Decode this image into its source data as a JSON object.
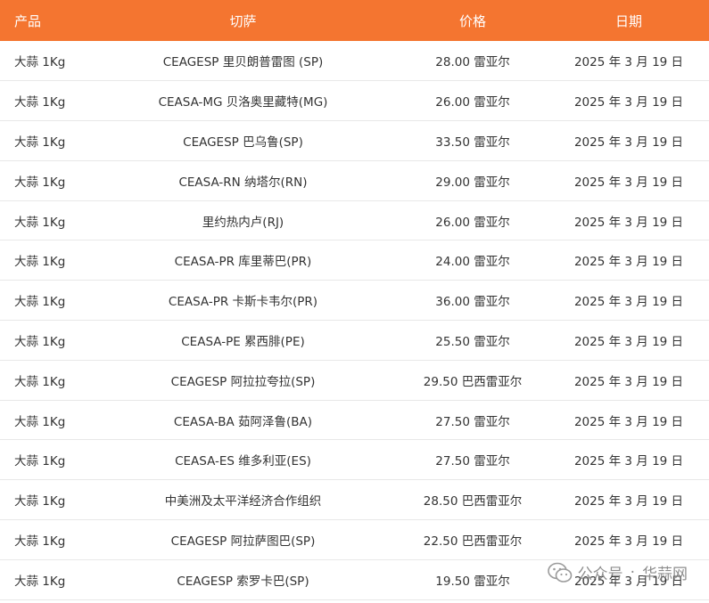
{
  "colors": {
    "header_background": "#f47530",
    "header_text": "#ffffff",
    "body_text": "#333333",
    "row_divider": "#e8e8e8"
  },
  "table": {
    "headers": {
      "product": "产品",
      "market": "切萨",
      "price": "价格",
      "date": "日期"
    },
    "rows": [
      {
        "product": "大蒜 1Kg",
        "market": "CEAGESP 里贝朗普雷图 (SP)",
        "price": "28.00 雷亚尔",
        "date": "2025 年 3 月 19 日"
      },
      {
        "product": "大蒜 1Kg",
        "market": "CEASA-MG 贝洛奥里藏特(MG)",
        "price": "26.00 雷亚尔",
        "date": "2025 年 3 月 19 日"
      },
      {
        "product": "大蒜 1Kg",
        "market": "CEAGESP 巴乌鲁(SP)",
        "price": "33.50 雷亚尔",
        "date": "2025 年 3 月 19 日"
      },
      {
        "product": "大蒜 1Kg",
        "market": "CEASA-RN 纳塔尔(RN)",
        "price": "29.00 雷亚尔",
        "date": "2025 年 3 月 19 日"
      },
      {
        "product": "大蒜 1Kg",
        "market": "里约热内卢(RJ)",
        "price": "26.00 雷亚尔",
        "date": "2025 年 3 月 19 日"
      },
      {
        "product": "大蒜 1Kg",
        "market": "CEASA-PR 库里蒂巴(PR)",
        "price": "24.00 雷亚尔",
        "date": "2025 年 3 月 19 日"
      },
      {
        "product": "大蒜 1Kg",
        "market": "CEASA-PR 卡斯卡韦尔(PR)",
        "price": "36.00 雷亚尔",
        "date": "2025 年 3 月 19 日"
      },
      {
        "product": "大蒜 1Kg",
        "market": "CEASA-PE 累西腓(PE)",
        "price": "25.50 雷亚尔",
        "date": "2025 年 3 月 19 日"
      },
      {
        "product": "大蒜 1Kg",
        "market": "CEAGESP 阿拉拉夸拉(SP)",
        "price": "29.50 巴西雷亚尔",
        "date": "2025 年 3 月 19 日"
      },
      {
        "product": "大蒜 1Kg",
        "market": "CEASA-BA 茹阿泽鲁(BA)",
        "price": "27.50 雷亚尔",
        "date": "2025 年 3 月 19 日"
      },
      {
        "product": "大蒜 1Kg",
        "market": "CEASA-ES 维多利亚(ES)",
        "price": "27.50 雷亚尔",
        "date": "2025 年 3 月 19 日"
      },
      {
        "product": "大蒜 1Kg",
        "market": "中美洲及太平洋经济合作组织",
        "price": "28.50 巴西雷亚尔",
        "date": "2025 年 3 月 19 日"
      },
      {
        "product": "大蒜 1Kg",
        "market": "CEAGESP 阿拉萨图巴(SP)",
        "price": "22.50 巴西雷亚尔",
        "date": "2025 年 3 月 19 日"
      },
      {
        "product": "大蒜 1Kg",
        "market": "CEAGESP 索罗卡巴(SP)",
        "price": "19.50 雷亚尔",
        "date": "2025 年 3 月 19 日"
      }
    ]
  },
  "watermark": {
    "icon": "wechat-icon",
    "prefix": "公众号",
    "separator": "·",
    "name": "华蒜网"
  }
}
